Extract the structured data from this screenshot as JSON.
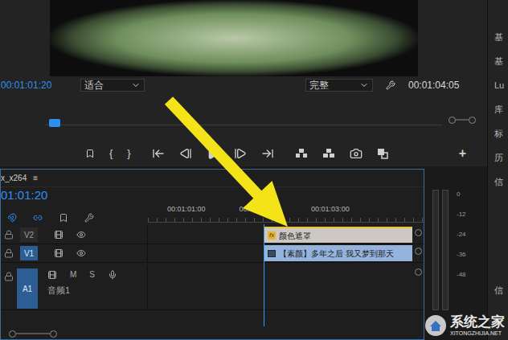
{
  "program_monitor": {
    "timecode": "00:01:01:20",
    "zoom": "适合",
    "quality": "完整",
    "duration": "00:01:04:05",
    "playhead_level": 0.01
  },
  "transport": {
    "mark_in": "{",
    "mark_out": "}",
    "add": "+"
  },
  "timeline": {
    "sequence": "x_x264",
    "menu": "≡",
    "timecode": "01:01:20",
    "ruler": [
      "00:01:01:00",
      "00:01:02:00",
      "00:01:03:00"
    ],
    "tracks": [
      {
        "label": "V2",
        "kind": "video",
        "selected": false,
        "clip": {
          "name": "颜色遮罩",
          "badge": "fx"
        }
      },
      {
        "label": "V1",
        "kind": "video",
        "selected": true,
        "clip": {
          "name": "【素颜】多年之后 我又梦到那天",
          "badge": ""
        }
      },
      {
        "label": "A1",
        "kind": "audio",
        "selected": true,
        "name": "音频1",
        "buttons": [
          "M",
          "S"
        ]
      }
    ]
  },
  "meter": {
    "scale": [
      "0",
      "-12",
      "-24",
      "-36",
      "-48"
    ],
    "level": 0
  },
  "side_tabs": [
    "基",
    "基",
    "Lu",
    "库",
    "标",
    "历",
    "信"
  ],
  "side_bottom": "信",
  "watermark": {
    "title": "系统之家",
    "url": "XITONGZHIJIA.NET"
  }
}
